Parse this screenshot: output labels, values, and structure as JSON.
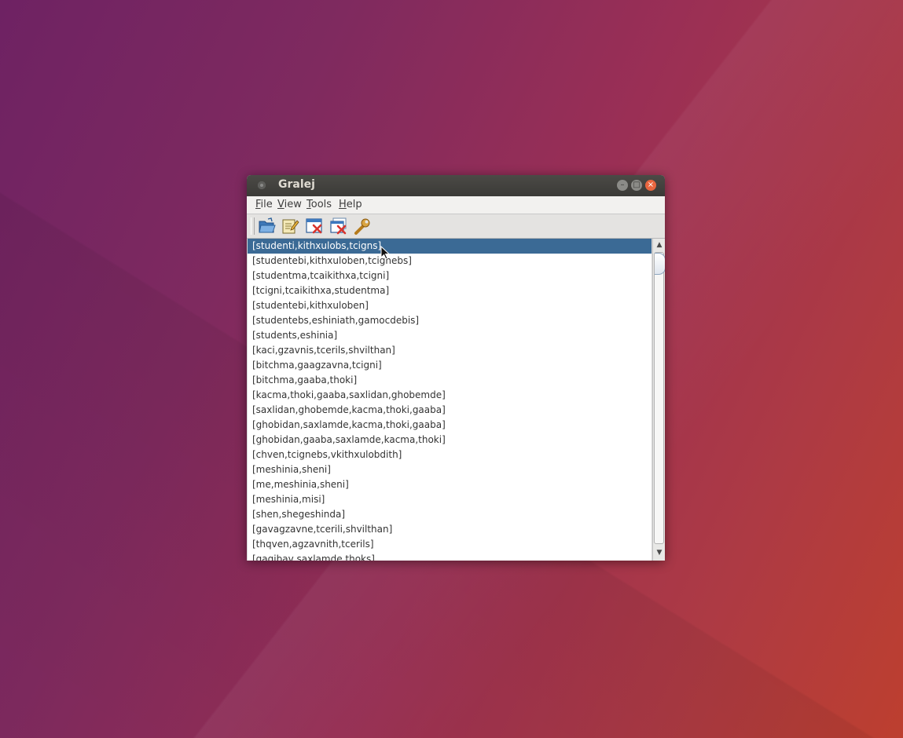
{
  "window": {
    "title": "Gralej"
  },
  "menubar": {
    "items": [
      {
        "label": "File"
      },
      {
        "label": "View"
      },
      {
        "label": "Tools"
      },
      {
        "label": "Help"
      }
    ]
  },
  "toolbar": {
    "buttons": [
      {
        "icon": "open-folder-icon"
      },
      {
        "icon": "edit-document-icon"
      },
      {
        "icon": "close-window-icon"
      },
      {
        "icon": "close-all-icon"
      },
      {
        "icon": "wrench-settings-icon"
      }
    ]
  },
  "list": {
    "selected_index": 0,
    "items": [
      "[studenti,kithxulobs,tcigns]",
      "[studentebi,kithxuloben,tcignebs]",
      "[studentma,tcaikithxa,tcigni]",
      "[tcigni,tcaikithxa,studentma]",
      "[studentebi,kithxuloben]",
      "[studentebs,eshiniath,gamocdebis]",
      "[students,eshinia]",
      "[kaci,gzavnis,tcerils,shvilthan]",
      "[bitchma,gaagzavna,tcigni]",
      "[bitchma,gaaba,thoki]",
      "[kacma,thoki,gaaba,saxlidan,ghobemde]",
      "[saxlidan,ghobemde,kacma,thoki,gaaba]",
      "[ghobidan,saxlamde,kacma,thoki,gaaba]",
      "[ghobidan,gaaba,saxlamde,kacma,thoki]",
      "[chven,tcignebs,vkithxulobdith]",
      "[meshinia,sheni]",
      "[me,meshinia,sheni]",
      "[meshinia,misi]",
      "[shen,shegeshinda]",
      "[gavagzavne,tcerili,shvilthan]",
      "[thqven,agzavnith,tcerils]",
      "[gagibav,saxlamde,thoks]"
    ]
  },
  "colors": {
    "selection": "#3b6a95",
    "titlebar": "#3c3b37",
    "close_button": "#e9663f"
  }
}
